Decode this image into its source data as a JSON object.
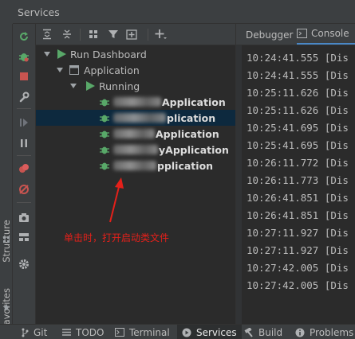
{
  "window": {
    "title": "Services"
  },
  "side_tabs": {
    "structure": "Structure",
    "favorites": "Favorites"
  },
  "tree": {
    "root": "Run Dashboard",
    "group": "Application",
    "status": "Running",
    "apps": [
      "Application",
      "plication",
      "Application",
      "yApplication",
      "pplication"
    ],
    "selected_index": 1
  },
  "annotation": {
    "text": "单击时，打开启动类文件",
    "color": "#e4201a"
  },
  "right_tabs": {
    "debugger": "Debugger",
    "console": "Console"
  },
  "console": {
    "lines": [
      "10:24:41.555 [Dis",
      "10:24:41.555 [Dis",
      "10:25:11.626 [Dis",
      "10:25:11.626 [Dis",
      "10:25:41.695 [Dis",
      "10:25:41.695 [Dis",
      "10:26:11.772 [Dis",
      "10:26:11.773 [Dis",
      "10:26:41.851 [Dis",
      "10:26:41.851 [Dis",
      "10:27:11.927 [Dis",
      "10:27:11.927 [Dis",
      "10:27:42.005 [Dis",
      "10:27:42.005 [Dis"
    ]
  },
  "bottom_tabs": {
    "git": "Git",
    "todo": "TODO",
    "terminal": "Terminal",
    "services": "Services",
    "build": "Build",
    "problems": "Problems"
  },
  "colors": {
    "accent_green": "#59a869",
    "stop_red": "#c75450",
    "selection": "#0d293e",
    "tab_underline": "#4a88c7"
  },
  "icons": {
    "strip": [
      "layout-icon",
      "star-icon"
    ],
    "vertical_toolbar": [
      "rerun-icon",
      "debug-bug-icon",
      "stop-icon",
      "wrench-icon",
      "resume-icon",
      "pause-icon",
      "breakpoints-icon",
      "mute-breakpoints-icon",
      "camera-icon",
      "layout-grid-icon",
      "settings-icon"
    ],
    "top_toolbar": [
      "expand-all-icon",
      "collapse-all-icon",
      "group-icon",
      "filter-icon",
      "add-service-icon",
      "add-icon"
    ]
  }
}
